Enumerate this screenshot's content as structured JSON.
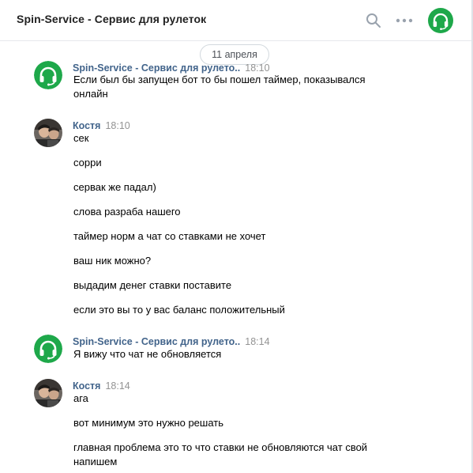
{
  "header": {
    "title": "Spin-Service - Сервис для рулеток",
    "icons": [
      "search-icon",
      "more-icon",
      "headphones-avatar-icon"
    ]
  },
  "feed": {
    "date_separator": "11 апреля",
    "groups": [
      {
        "author": "Spin-Service - Сервис для рулето..",
        "time": "18:10",
        "avatar": "headphones-logo",
        "messages": [
          "Если был бы запущен бот то бы пошел таймер, показывался",
          "онлайн"
        ]
      },
      {
        "author": "Костя",
        "time": "18:10",
        "avatar": "user-photo",
        "messages": [
          "сек",
          "сорри",
          "сервак же падал)",
          "слова разраба нашего",
          "таймер норм а чат со ставками не хочет",
          "ваш ник можно?",
          "выдадим денег ставки поставите",
          "если это вы то у вас баланс положительный"
        ]
      },
      {
        "author": "Spin-Service - Сервис для рулето..",
        "time": "18:14",
        "avatar": "headphones-logo",
        "messages": [
          "Я вижу что чат не обновляется"
        ]
      },
      {
        "author": "Костя",
        "time": "18:14",
        "avatar": "user-photo",
        "messages": [
          "ага",
          "вот минимум это нужно решать",
          "главная проблема это то что ставки не обновляются чат свой",
          "напишем"
        ]
      }
    ]
  },
  "colors": {
    "brand_green": "#1ea84a",
    "author_link": "#42648b",
    "time_gray": "#939393",
    "border": "#e7e8ec"
  }
}
